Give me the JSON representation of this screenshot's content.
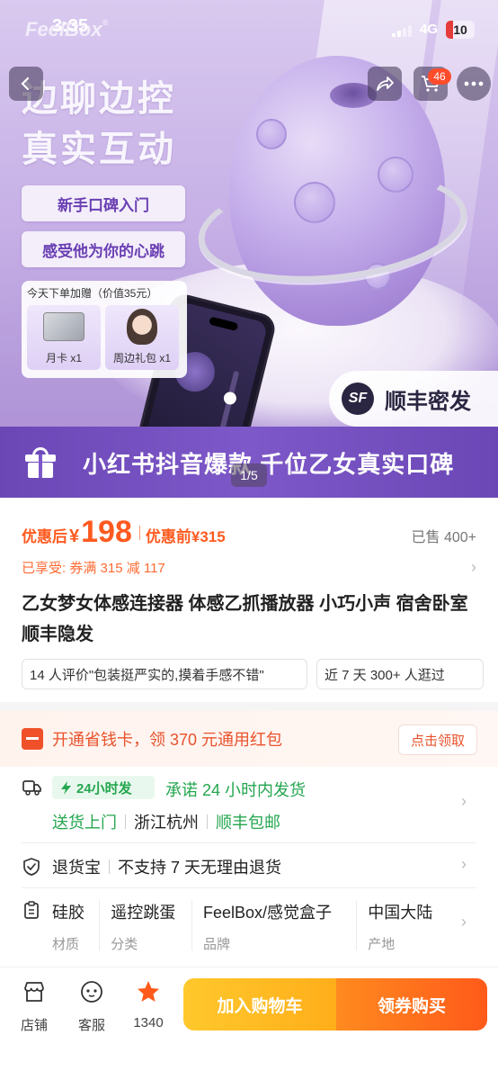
{
  "status_bar": {
    "time": "3:35",
    "network": "4G",
    "battery": "10"
  },
  "hero": {
    "brand_logo": "FeelBox",
    "title_line1": "边聊边控",
    "title_line2": "真实互动",
    "pill1": "新手口碑入门",
    "pill2": "感受他为你的心跳",
    "gift_title": "今天下单加赠（价值35元）",
    "gift_items": [
      {
        "label": "月卡 x1",
        "icon": "card-icon"
      },
      {
        "label": "周边礼包 x1",
        "icon": "figure-icon"
      }
    ],
    "sf_logo": "SF",
    "sf_text": "顺丰密发",
    "promo_text": "小红书抖音爆款  千位乙女真实口碑",
    "image_indicator": "1/5",
    "cart_badge": "46"
  },
  "product": {
    "price_after_label": "优惠后",
    "currency": "¥",
    "price_after": "198",
    "price_before": "优惠前¥315",
    "sold": "已售 400+",
    "coupon_line": "已享受: 券满 315 减 117",
    "title": "乙女梦女体感连接器 体感乙抓播放器 小巧小声 宿舍卧室 顺丰隐发",
    "review_chip": "14 人评价\"包装挺严实的,摸着手感不错\"",
    "visit_chip": "近 7 天 300+ 人逛过"
  },
  "membership": {
    "text": "开通省钱卡，领 370 元通用红包",
    "button": "点击领取"
  },
  "delivery": {
    "badge": "24小时发",
    "promise": "承诺 24 小时内发货",
    "door": "送货上门",
    "location": "浙江杭州",
    "shipping": "顺丰包邮"
  },
  "returns": {
    "label": "退货宝",
    "policy": "不支持 7 天无理由退货"
  },
  "specs": [
    {
      "value": "硅胶",
      "key": "材质"
    },
    {
      "value": "遥控跳蛋",
      "key": "分类"
    },
    {
      "value": "FeelBox/感觉盒子",
      "key": "品牌"
    },
    {
      "value": "中国大陆",
      "key": "产地"
    }
  ],
  "bottom_bar": {
    "store": "店铺",
    "service": "客服",
    "fav_count": "1340",
    "add_cart": "加入购物车",
    "buy": "领券购买"
  },
  "colors": {
    "accent": "#ff5a1f",
    "green": "#24a64f",
    "purple": "#6b47b6",
    "cart_yellow": "#ffb81f"
  }
}
